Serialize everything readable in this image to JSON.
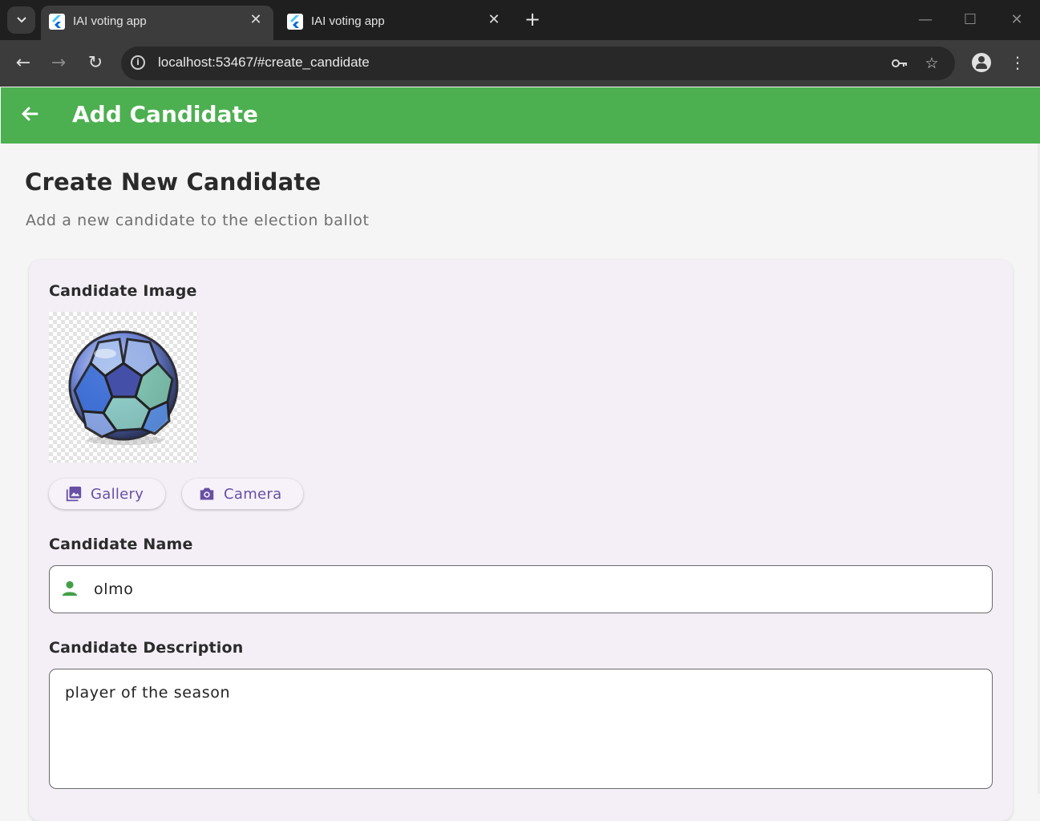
{
  "browser": {
    "tabs": [
      {
        "title": "IAI voting app",
        "active": true
      },
      {
        "title": "IAI voting app",
        "active": false
      }
    ],
    "url": "localhost:53467/#create_candidate"
  },
  "appbar": {
    "title": "Add Candidate",
    "color": "#4caf50"
  },
  "page": {
    "title": "Create New Candidate",
    "subtitle": "Add a new candidate to the election ballot"
  },
  "form": {
    "image_label": "Candidate Image",
    "gallery_label": "Gallery",
    "camera_label": "Camera",
    "name_label": "Candidate Name",
    "name_value": "olmo",
    "description_label": "Candidate Description",
    "description_value": "player of the season"
  },
  "colors": {
    "accent": "#6750a4",
    "person_icon": "#43a047"
  }
}
